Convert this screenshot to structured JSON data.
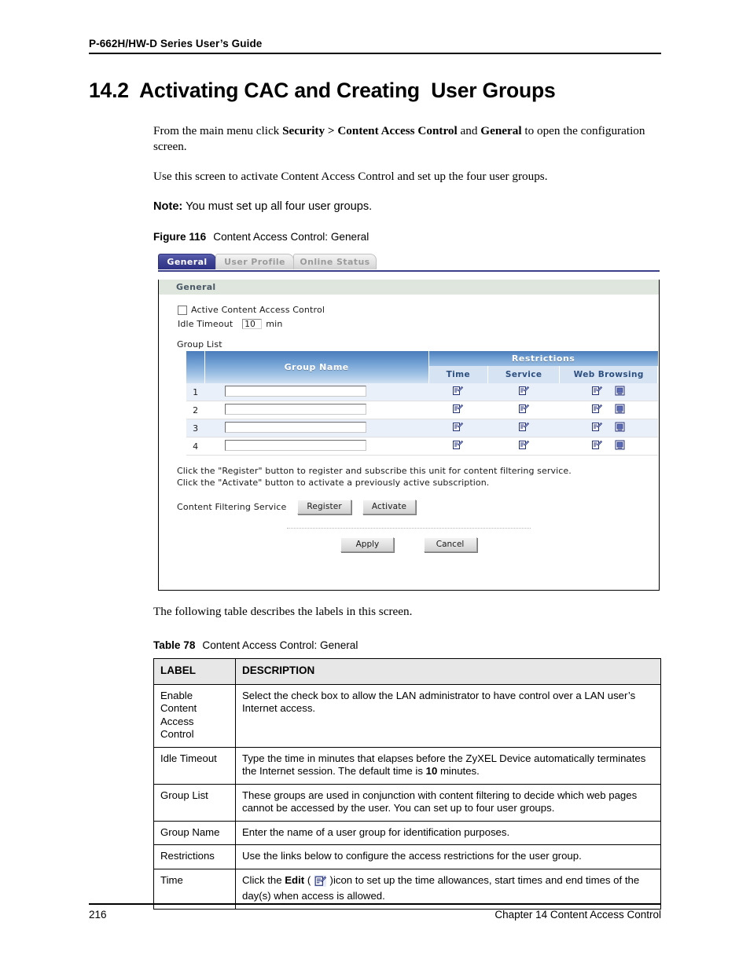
{
  "header": {
    "running_title": "P-662H/HW-D Series User’s Guide"
  },
  "section": {
    "heading": "14.2  Activating CAC and Creating  User Groups"
  },
  "body": {
    "para1_a": "From the main menu click ",
    "para1_b": "Security > Content Access Control",
    "para1_c": " and ",
    "para1_d": "General",
    "para1_e": " to open the configuration screen.",
    "para2": "Use this screen to activate Content Access Control and set up the four user groups.",
    "note_label": "Note:",
    "note_text": " You must set up all four user groups.",
    "figure_caption_num": "Figure 116",
    "figure_caption_text": "Content Access Control: General",
    "after_figure": "The following table describes the labels in this screen.",
    "table_caption_num": "Table 78",
    "table_caption_text": "Content Access Control: General"
  },
  "figure": {
    "tabs": [
      {
        "label": "General",
        "active": true
      },
      {
        "label": "User Profile",
        "active": false
      },
      {
        "label": "Online Status",
        "active": false
      }
    ],
    "section_bar": "General",
    "active_checkbox_label": "Active Content Access Control",
    "idle_timeout_label": "Idle Timeout",
    "idle_timeout_value": "10",
    "idle_timeout_unit": "min",
    "group_list_label": "Group List",
    "group_table": {
      "header_group_name": "Group Name",
      "header_restrictions": "Restrictions",
      "sub_headers": [
        "Time",
        "Service",
        "Web Browsing"
      ],
      "rows": [
        {
          "index": "1",
          "name": ""
        },
        {
          "index": "2",
          "name": ""
        },
        {
          "index": "3",
          "name": ""
        },
        {
          "index": "4",
          "name": ""
        }
      ]
    },
    "note_line1": "Click the \"Register\" button to register and subscribe this unit for content filtering service.",
    "note_line2": "Click the \"Activate\" button to activate a previously active subscription.",
    "cfs_label": "Content Filtering Service",
    "btn_register": "Register",
    "btn_activate": "Activate",
    "btn_apply": "Apply",
    "btn_cancel": "Cancel",
    "icons": {
      "edit": "edit-icon",
      "web_browsing_extra": "monitor-icon"
    },
    "colors": {
      "tab_active_bg": "#3f4394",
      "section_bar_bg": "#dfe6de",
      "table_header_blue": "#4a7cbb",
      "table_subheader_blue": "#d6e3f2",
      "row_odd_bg": "#e9f0f9"
    }
  },
  "desc_table": {
    "columns": [
      "LABEL",
      "DESCRIPTION"
    ],
    "rows": [
      {
        "label": "Enable\nContent\nAccess\nControl",
        "desc_pre": "Select the check box to allow the LAN administrator to have control over a LAN user’s Internet access.",
        "desc_bold": "",
        "desc_post": ""
      },
      {
        "label": "Idle Timeout",
        "desc_pre": "Type the time in minutes that elapses before the ZyXEL Device automatically terminates the Internet session. The default time is ",
        "desc_bold": "10",
        "desc_post": " minutes."
      },
      {
        "label": "Group List",
        "desc_pre": "These groups are used in conjunction with content filtering to decide which web pages cannot be accessed by the user.  You can set up to four user groups.",
        "desc_bold": "",
        "desc_post": ""
      },
      {
        "label": "Group Name",
        "desc_pre": "Enter the name of a user group for identification purposes.",
        "desc_bold": "",
        "desc_post": ""
      },
      {
        "label": "Restrictions",
        "desc_pre": "Use the links below to configure the access restrictions for the user group.",
        "desc_bold": "",
        "desc_post": ""
      },
      {
        "label": "Time",
        "desc_pre": "Click the ",
        "desc_bold": "Edit",
        "desc_mid": " ( ",
        "desc_post": " )icon to set up the time allowances, start times and end times of the day(s) when access is allowed."
      }
    ]
  },
  "footer": {
    "page_number": "216",
    "chapter": "Chapter 14 Content Access Control"
  }
}
